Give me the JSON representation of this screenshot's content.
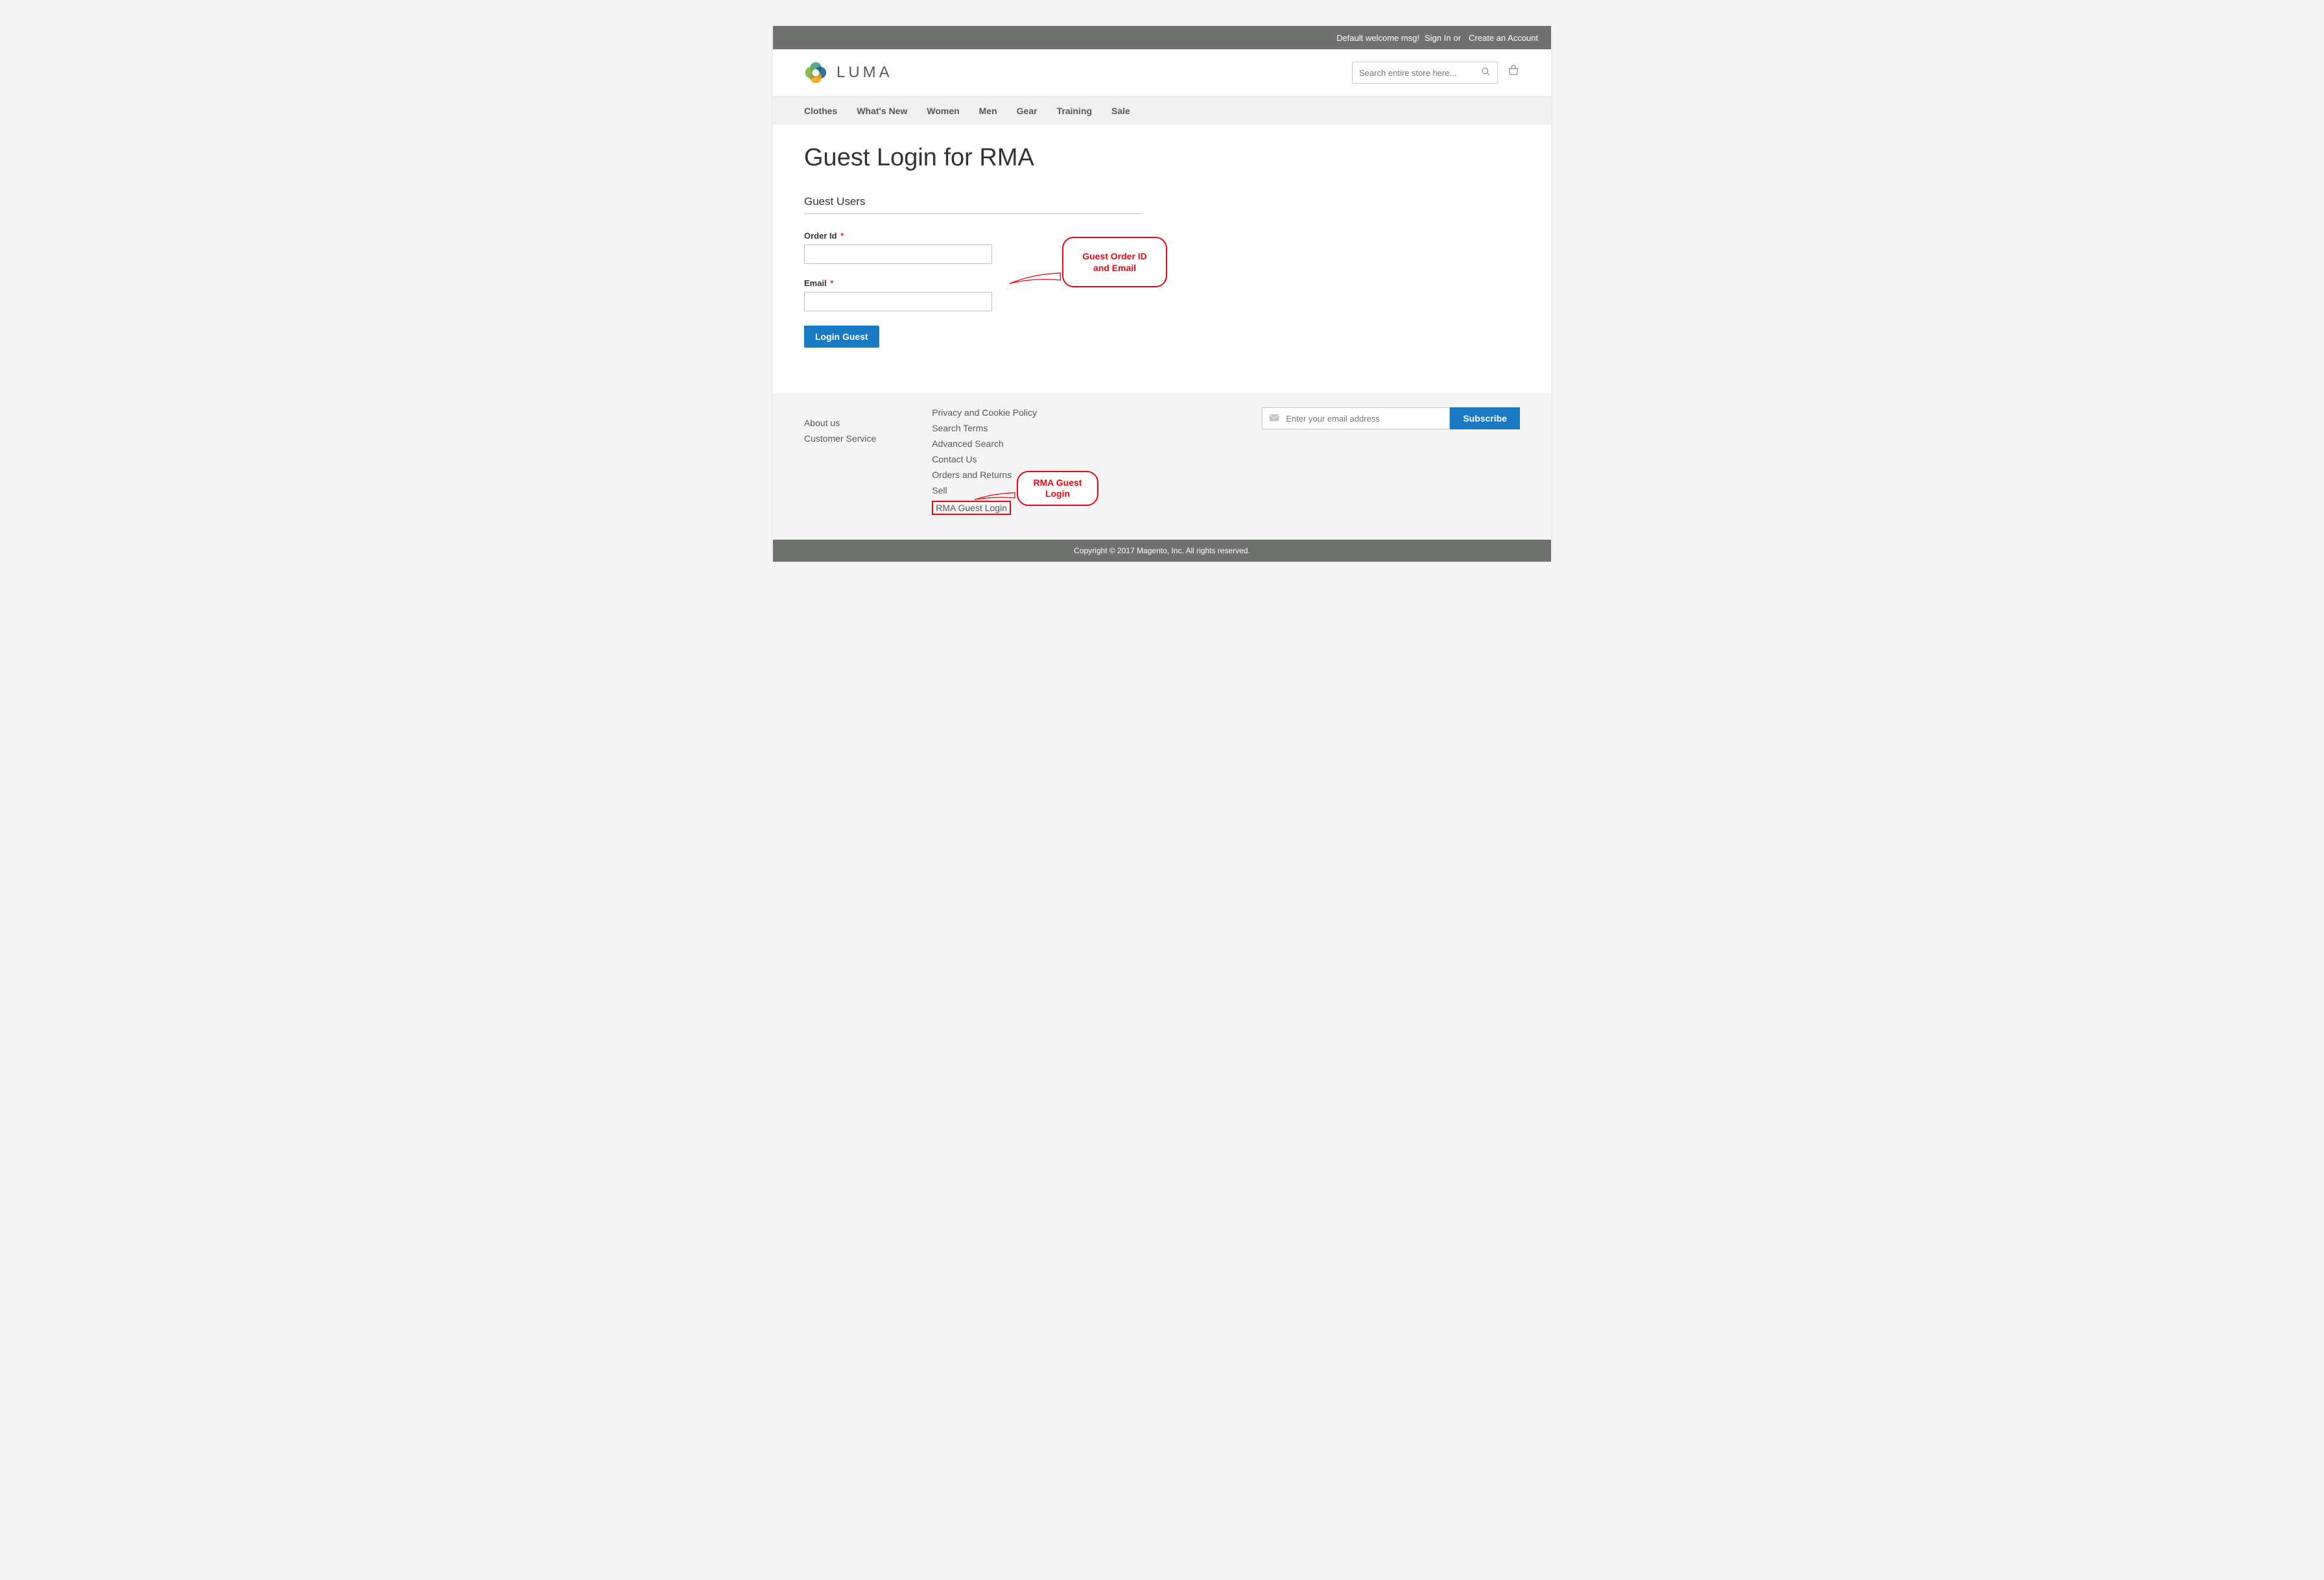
{
  "topbar": {
    "welcome": "Default welcome msg!",
    "signin": "Sign In",
    "or": "or",
    "create": "Create an Account"
  },
  "brand": {
    "name": "LUMA"
  },
  "search": {
    "placeholder": "Search entire store here..."
  },
  "nav": {
    "items": [
      {
        "label": "Clothes"
      },
      {
        "label": "What's New"
      },
      {
        "label": "Women"
      },
      {
        "label": "Men"
      },
      {
        "label": "Gear"
      },
      {
        "label": "Training"
      },
      {
        "label": "Sale"
      }
    ]
  },
  "page": {
    "title": "Guest Login for RMA",
    "section": "Guest Users",
    "order_id_label": "Order Id",
    "email_label": "Email",
    "submit": "Login Guest"
  },
  "callouts": {
    "c1": "Guest Order ID and Email",
    "c2": "RMA Guest Login"
  },
  "footer": {
    "col1": [
      {
        "label": "About us"
      },
      {
        "label": "Customer Service"
      }
    ],
    "col2": [
      {
        "label": "Privacy and Cookie Policy"
      },
      {
        "label": "Search Terms"
      },
      {
        "label": "Advanced Search"
      },
      {
        "label": "Contact Us"
      },
      {
        "label": "Orders and Returns"
      },
      {
        "label": "Sell"
      },
      {
        "label": "RMA Guest Login"
      }
    ],
    "newsletter_placeholder": "Enter your email address",
    "subscribe": "Subscribe",
    "copyright": "Copyright © 2017 Magento, Inc. All rights reserved."
  }
}
